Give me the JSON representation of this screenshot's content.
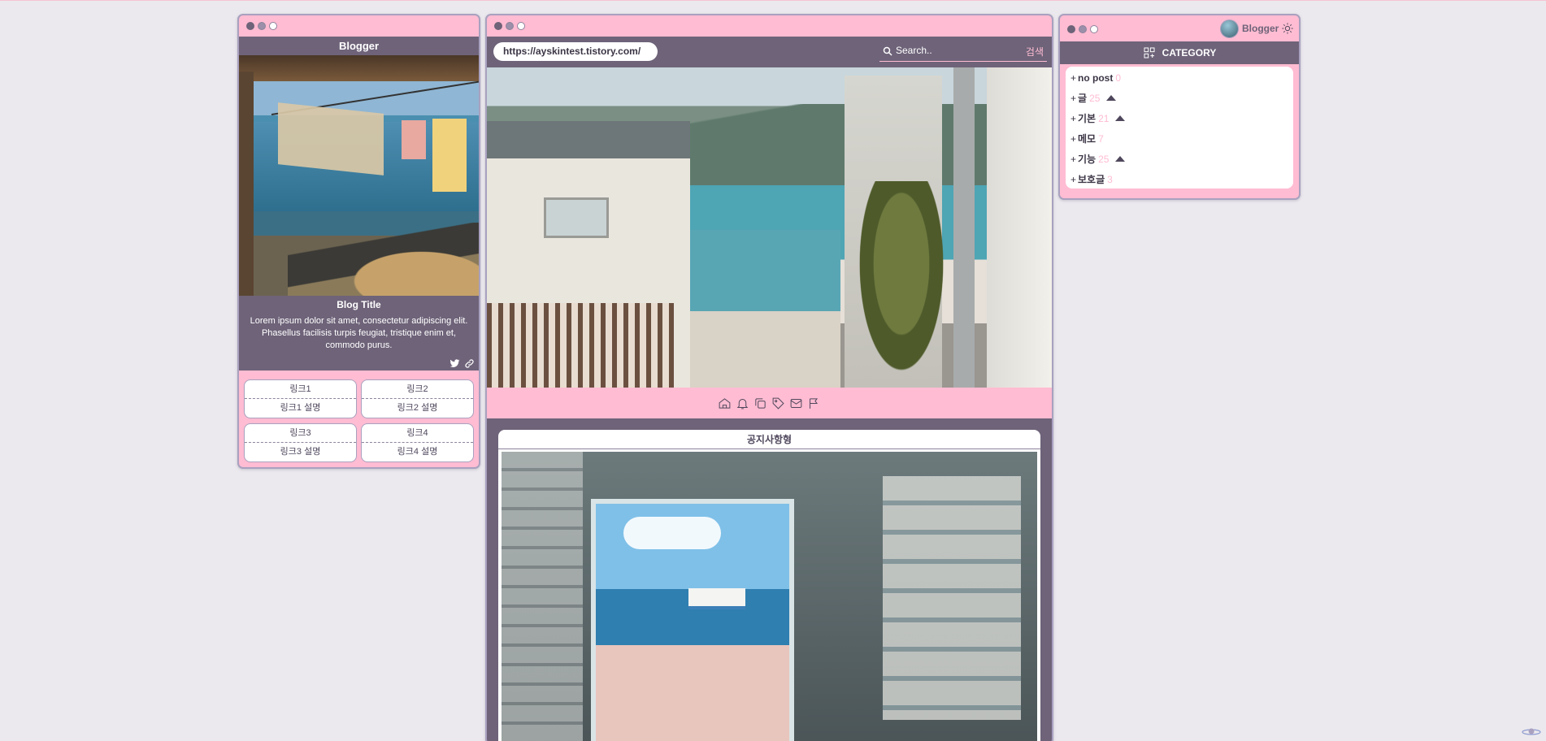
{
  "left": {
    "header": "Blogger",
    "blog_title": "Blog Title",
    "blog_desc": "Lorem ipsum dolor sit amet, consectetur adipiscing elit. Phasellus facilisis turpis feugiat, tristique enim et, commodo purus.",
    "social": [
      "twitter-icon",
      "link-icon"
    ],
    "links": [
      {
        "title": "링크1",
        "desc": "링크1 설명"
      },
      {
        "title": "링크2",
        "desc": "링크2 설명"
      },
      {
        "title": "링크3",
        "desc": "링크3 설명"
      },
      {
        "title": "링크4",
        "desc": "링크4 설명"
      }
    ]
  },
  "center": {
    "url": "https://ayskintest.tistory.com/",
    "search": {
      "placeholder": "Search..",
      "button": "검색"
    },
    "icons": [
      "home-icon",
      "bell-icon",
      "copy-icon",
      "tag-icon",
      "mail-icon",
      "flag-icon"
    ],
    "post_title": "공지사항형"
  },
  "right": {
    "account": "Blogger",
    "category_header": "CATEGORY",
    "categories": [
      {
        "plus": "+",
        "name": "no post",
        "count": "0",
        "up": false
      },
      {
        "plus": "+",
        "name": "글",
        "count": "25",
        "up": true
      },
      {
        "plus": "+",
        "name": "기본",
        "count": "21",
        "up": true
      },
      {
        "plus": "+",
        "name": "메모",
        "count": "7",
        "up": false
      },
      {
        "plus": "+",
        "name": "기능",
        "count": "25",
        "up": true
      },
      {
        "plus": "+",
        "name": "보호글",
        "count": "3",
        "up": false
      }
    ]
  },
  "colors": {
    "background": "#ebe9ee",
    "pink": "#ffbcd2",
    "dark": "#6e6379",
    "border": "#a9a1bf"
  }
}
